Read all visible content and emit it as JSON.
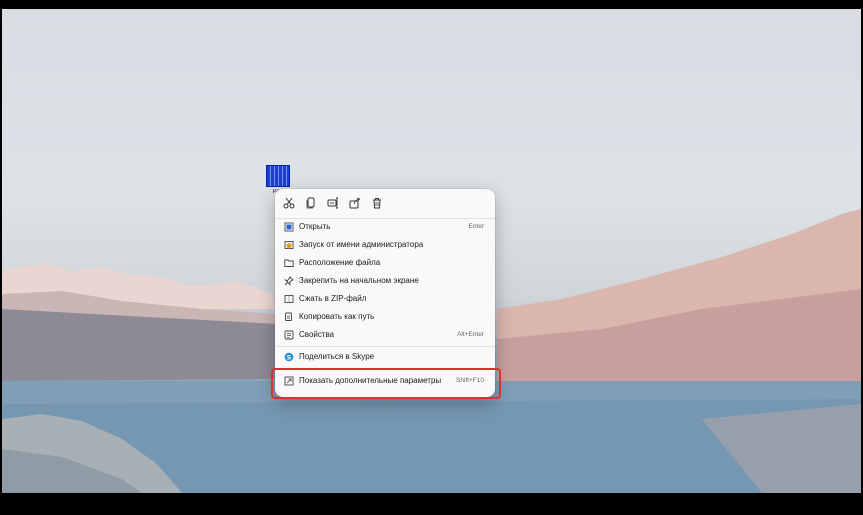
{
  "desktop_icon": {
    "label": "Par\\"
  },
  "context_menu": {
    "toolbar": [
      {
        "icon": "cut-icon"
      },
      {
        "icon": "copy-icon"
      },
      {
        "icon": "rename-icon"
      },
      {
        "icon": "share-icon"
      },
      {
        "icon": "delete-icon"
      }
    ],
    "items": [
      {
        "label": "Открыть",
        "shortcut": "Enter",
        "icon": "open-icon"
      },
      {
        "label": "Запуск от имени администратора",
        "shortcut": "",
        "icon": "admin-shield-icon"
      },
      {
        "label": "Расположение файла",
        "shortcut": "",
        "icon": "folder-icon"
      },
      {
        "label": "Закрепить на начальном экране",
        "shortcut": "",
        "icon": "pin-icon"
      },
      {
        "label": "Сжать в ZIP-файл",
        "shortcut": "",
        "icon": "zip-icon"
      },
      {
        "label": "Копировать как путь",
        "shortcut": "",
        "icon": "copy-path-icon"
      },
      {
        "label": "Свойства",
        "shortcut": "Alt+Enter",
        "icon": "properties-icon"
      },
      {
        "label": "Поделиться в Skype",
        "shortcut": "",
        "icon": "skype-icon"
      },
      {
        "label": "Показать дополнительные параметры",
        "shortcut": "Shift+F10",
        "icon": "more-options-icon"
      }
    ]
  },
  "colors": {
    "highlight": "#d93030",
    "menu_bg": "#f9f9f9",
    "skype": "#1e8fe1"
  }
}
